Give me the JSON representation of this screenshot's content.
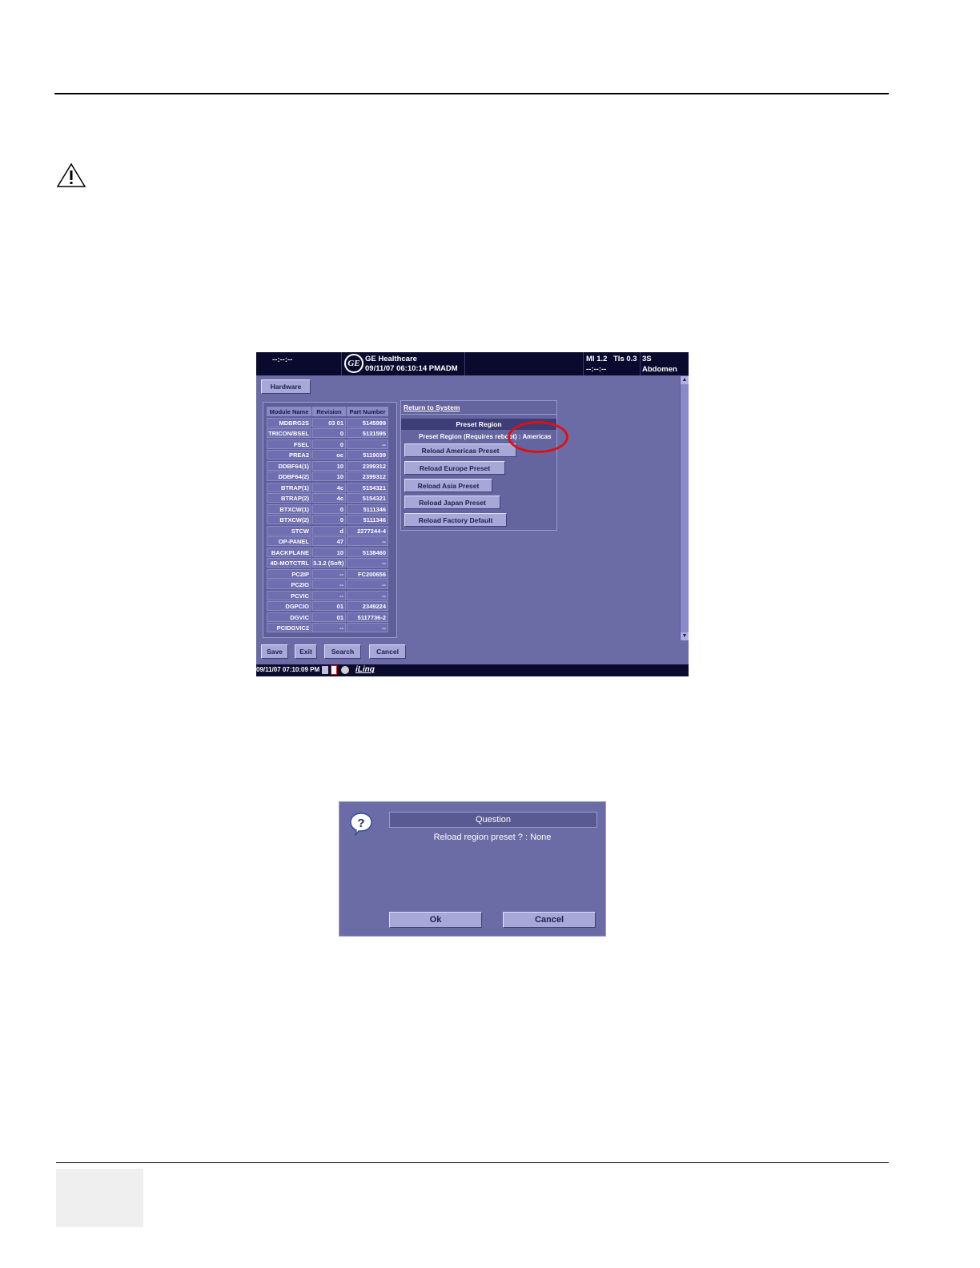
{
  "shot1": {
    "header": {
      "left_text": "--:--:--",
      "brand": "GE Healthcare",
      "datetime_user": "09/11/07 06:10:14 PMADM",
      "mi": "MI 1.2",
      "tis": "TIs 0.3",
      "probe": "3S",
      "dash": "--:--:--",
      "preset": "Abdomen"
    },
    "hardware_tab": "Hardware",
    "table": {
      "headers": [
        "Module Name",
        "Revision",
        "Part Number"
      ],
      "rows": [
        [
          "MDBRG2S",
          "03 01",
          "5145999"
        ],
        [
          "TRICON/BSEL",
          "0",
          "5131595"
        ],
        [
          "FSEL",
          "0",
          "--"
        ],
        [
          "PREA2",
          "oc",
          "5119039"
        ],
        [
          "DDBF64(1)",
          "10",
          "2399312"
        ],
        [
          "DDBF64(2)",
          "10",
          "2399312"
        ],
        [
          "BTRAP(1)",
          "4c",
          "5154321"
        ],
        [
          "BTRAP(2)",
          "4c",
          "5154321"
        ],
        [
          "BTXCW(1)",
          "0",
          "5111346"
        ],
        [
          "BTXCW(2)",
          "0",
          "5111346"
        ],
        [
          "STCW",
          "d",
          "2277244-4"
        ],
        [
          "OP-PANEL",
          "47",
          "--"
        ],
        [
          "BACKPLANE",
          "10",
          "5138460"
        ],
        [
          "4D-MOTCTRL",
          "3.3.2 (Soft)",
          "--"
        ],
        [
          "PC2IP",
          "--",
          "FC200656"
        ],
        [
          "PC2IO",
          "--",
          "--"
        ],
        [
          "PCVIC",
          "--",
          "--"
        ],
        [
          "DGPCIO",
          "01",
          "2349224"
        ],
        [
          "DGVIC",
          "01",
          "5117736-2"
        ],
        [
          "PCIDGVIC2",
          "--",
          "--"
        ]
      ]
    },
    "return_to_system": "Return to System",
    "preset_region_title": "Preset Region",
    "preset_region_status": "Preset Region (Requires reboot) : Americas",
    "reload_buttons": [
      "Reload Americas Preset",
      "Reload Europe Preset",
      "Reload Asia Preset",
      "Reload Japan Preset",
      "Reload Factory Default"
    ],
    "bottom_buttons": [
      "Save",
      "Exit",
      "Search",
      "Cancel"
    ],
    "footer_time": "09/11/07 07:10:09 PM",
    "footer_logo": "iLinq"
  },
  "dialog": {
    "title": "Question",
    "message": "Reload region preset ? : None",
    "ok": "Ok",
    "cancel": "Cancel"
  },
  "colors": {
    "screen_bg": "#6b6ba6",
    "header_bg": "#0a0a2e",
    "highlight_circle": "#e01010"
  }
}
